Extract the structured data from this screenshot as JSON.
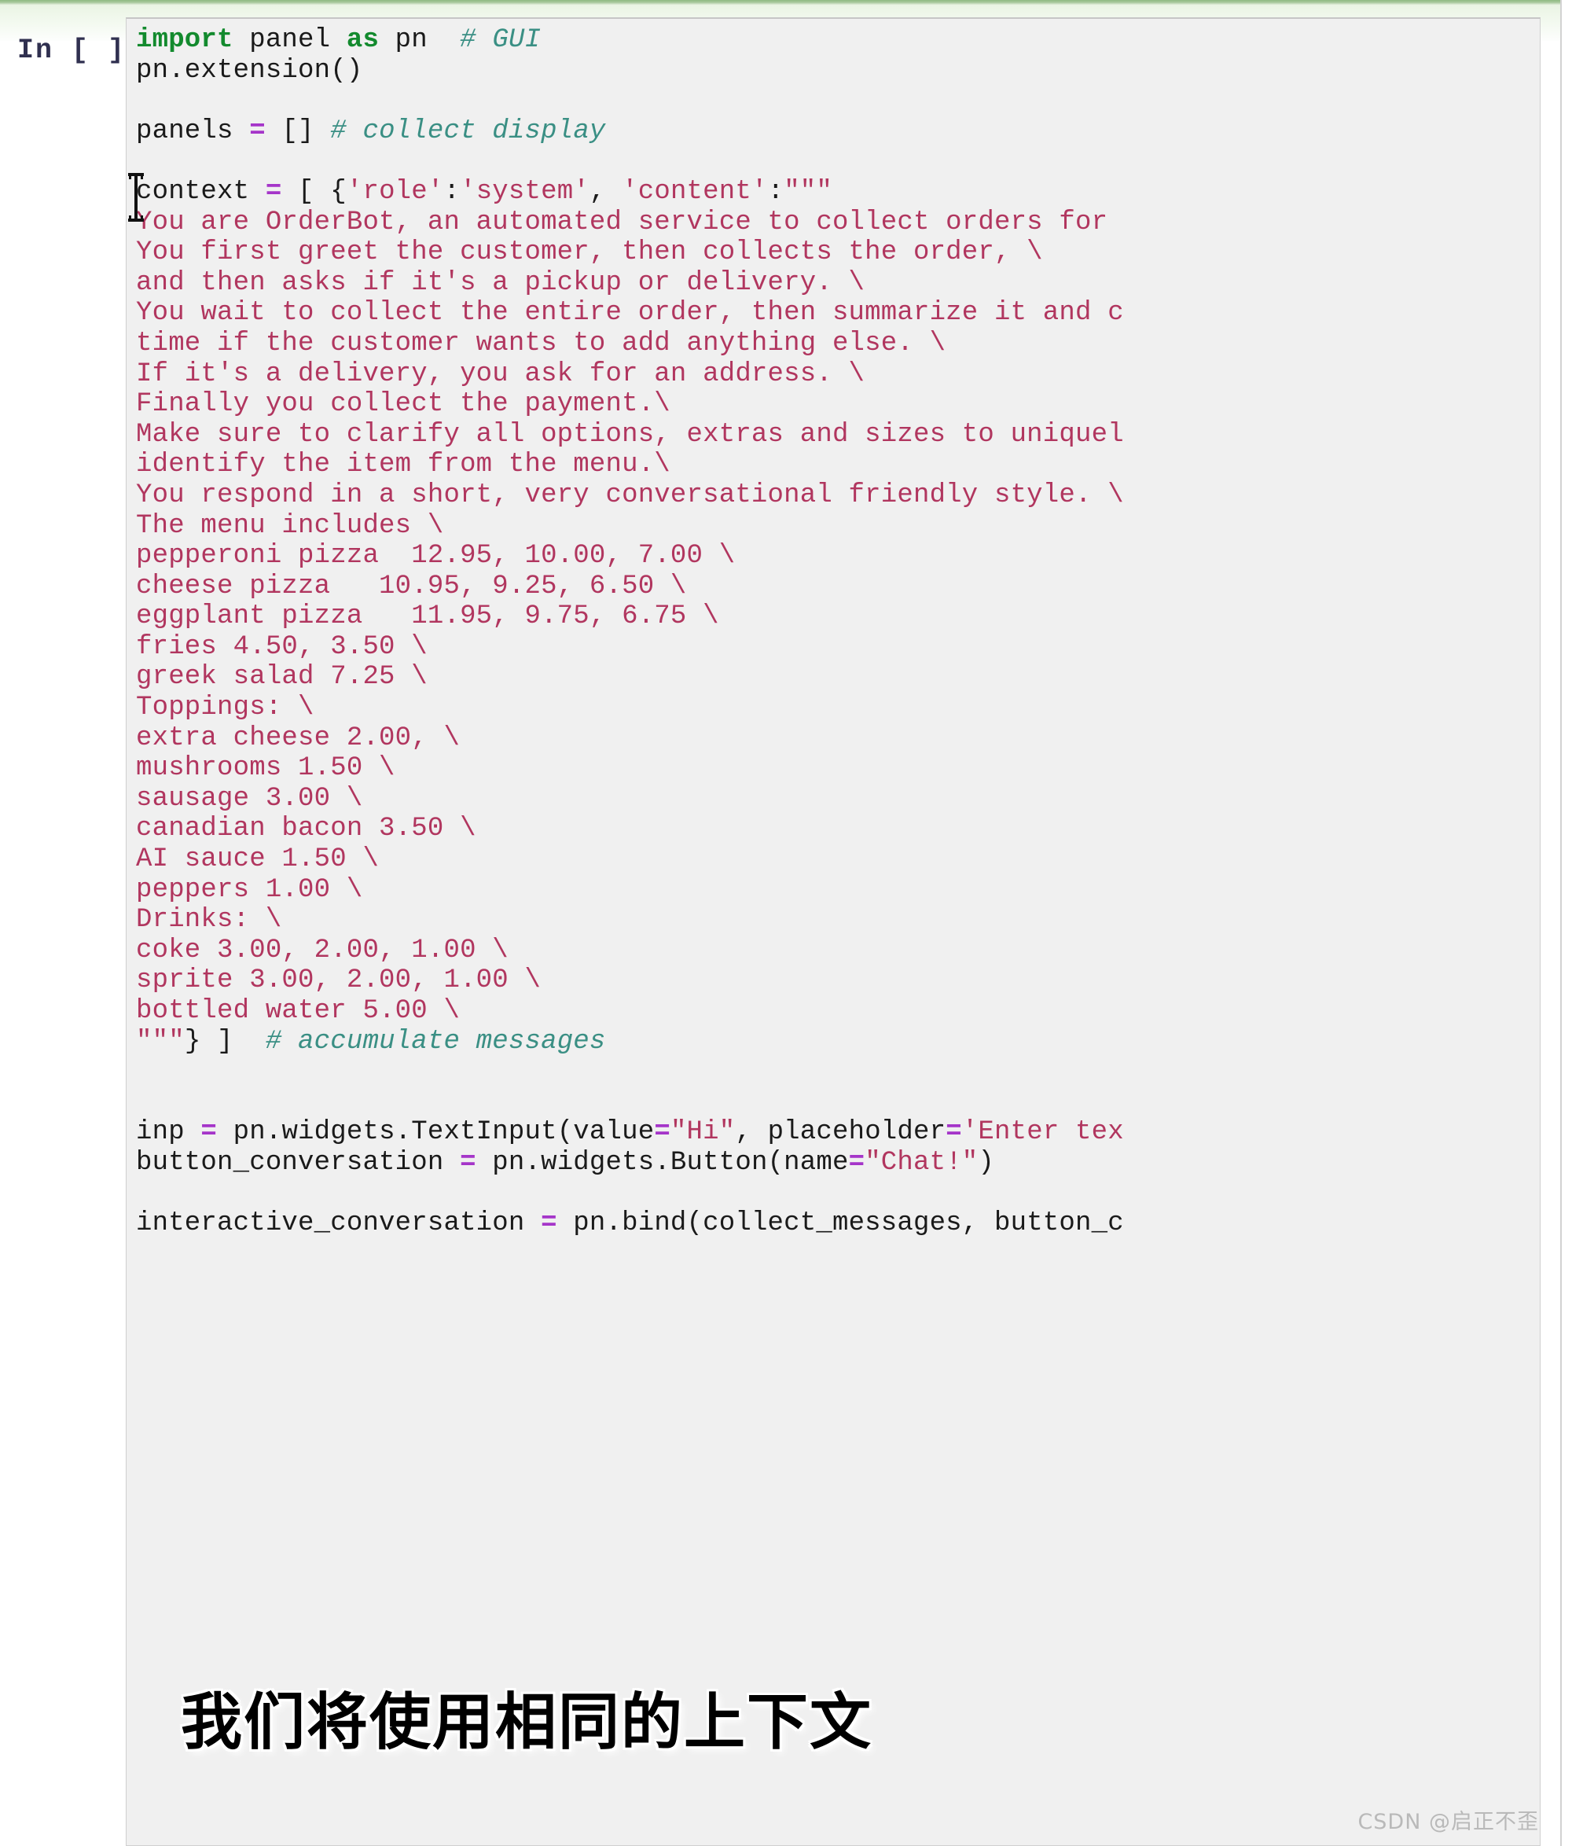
{
  "notebook": {
    "prompt_label": "In [ ]:",
    "cell_type": "code",
    "kernel_language": "python"
  },
  "code": {
    "lines": [
      [
        {
          "t": "kw",
          "s": "import"
        },
        {
          "t": "plain",
          "s": " panel "
        },
        {
          "t": "kw",
          "s": "as"
        },
        {
          "t": "plain",
          "s": " pn  "
        },
        {
          "t": "comment",
          "s": "# GUI"
        }
      ],
      [
        {
          "t": "plain",
          "s": "pn.extension()"
        }
      ],
      [
        {
          "t": "plain",
          "s": ""
        }
      ],
      [
        {
          "t": "plain",
          "s": "panels "
        },
        {
          "t": "op",
          "s": "="
        },
        {
          "t": "plain",
          "s": " [] "
        },
        {
          "t": "comment",
          "s": "# collect display"
        }
      ],
      [
        {
          "t": "plain",
          "s": ""
        }
      ],
      [
        {
          "t": "plain",
          "s": "context "
        },
        {
          "t": "op",
          "s": "="
        },
        {
          "t": "plain",
          "s": " [ {"
        },
        {
          "t": "str",
          "s": "'role'"
        },
        {
          "t": "punct",
          "s": ":"
        },
        {
          "t": "str",
          "s": "'system'"
        },
        {
          "t": "punct",
          "s": ", "
        },
        {
          "t": "str",
          "s": "'content'"
        },
        {
          "t": "punct",
          "s": ":"
        },
        {
          "t": "str",
          "s": "\"\"\""
        }
      ],
      [
        {
          "t": "str",
          "s": "You are OrderBot, an automated service to collect orders for"
        }
      ],
      [
        {
          "t": "str",
          "s": "You first greet the customer, then collects the order, \\"
        }
      ],
      [
        {
          "t": "str",
          "s": "and then asks if it's a pickup or delivery. \\"
        }
      ],
      [
        {
          "t": "str",
          "s": "You wait to collect the entire order, then summarize it and c"
        }
      ],
      [
        {
          "t": "str",
          "s": "time if the customer wants to add anything else. \\"
        }
      ],
      [
        {
          "t": "str",
          "s": "If it's a delivery, you ask for an address. \\"
        }
      ],
      [
        {
          "t": "str",
          "s": "Finally you collect the payment.\\"
        }
      ],
      [
        {
          "t": "str",
          "s": "Make sure to clarify all options, extras and sizes to uniquel"
        }
      ],
      [
        {
          "t": "str",
          "s": "identify the item from the menu.\\"
        }
      ],
      [
        {
          "t": "str",
          "s": "You respond in a short, very conversational friendly style. \\"
        }
      ],
      [
        {
          "t": "str",
          "s": "The menu includes \\"
        }
      ],
      [
        {
          "t": "str",
          "s": "pepperoni pizza  12.95, 10.00, 7.00 \\"
        }
      ],
      [
        {
          "t": "str",
          "s": "cheese pizza   10.95, 9.25, 6.50 \\"
        }
      ],
      [
        {
          "t": "str",
          "s": "eggplant pizza   11.95, 9.75, 6.75 \\"
        }
      ],
      [
        {
          "t": "str",
          "s": "fries 4.50, 3.50 \\"
        }
      ],
      [
        {
          "t": "str",
          "s": "greek salad 7.25 \\"
        }
      ],
      [
        {
          "t": "str",
          "s": "Toppings: \\"
        }
      ],
      [
        {
          "t": "str",
          "s": "extra cheese 2.00, \\"
        }
      ],
      [
        {
          "t": "str",
          "s": "mushrooms 1.50 \\"
        }
      ],
      [
        {
          "t": "str",
          "s": "sausage 3.00 \\"
        }
      ],
      [
        {
          "t": "str",
          "s": "canadian bacon 3.50 \\"
        }
      ],
      [
        {
          "t": "str",
          "s": "AI sauce 1.50 \\"
        }
      ],
      [
        {
          "t": "str",
          "s": "peppers 1.00 \\"
        }
      ],
      [
        {
          "t": "str",
          "s": "Drinks: \\"
        }
      ],
      [
        {
          "t": "str",
          "s": "coke 3.00, 2.00, 1.00 \\"
        }
      ],
      [
        {
          "t": "str",
          "s": "sprite 3.00, 2.00, 1.00 \\"
        }
      ],
      [
        {
          "t": "str",
          "s": "bottled water 5.00 \\"
        }
      ],
      [
        {
          "t": "str",
          "s": "\"\"\""
        },
        {
          "t": "punct",
          "s": "} ]  "
        },
        {
          "t": "comment",
          "s": "# accumulate messages"
        }
      ],
      [
        {
          "t": "plain",
          "s": ""
        }
      ],
      [
        {
          "t": "plain",
          "s": ""
        }
      ],
      [
        {
          "t": "plain",
          "s": "inp "
        },
        {
          "t": "op",
          "s": "="
        },
        {
          "t": "plain",
          "s": " pn.widgets.TextInput(value"
        },
        {
          "t": "op",
          "s": "="
        },
        {
          "t": "str",
          "s": "\"Hi\""
        },
        {
          "t": "punct",
          "s": ", "
        },
        {
          "t": "plain",
          "s": "placeholder"
        },
        {
          "t": "op",
          "s": "="
        },
        {
          "t": "str",
          "s": "'Enter tex"
        }
      ],
      [
        {
          "t": "plain",
          "s": "button_conversation "
        },
        {
          "t": "op",
          "s": "="
        },
        {
          "t": "plain",
          "s": " pn.widgets.Button(name"
        },
        {
          "t": "op",
          "s": "="
        },
        {
          "t": "str",
          "s": "\"Chat!\""
        },
        {
          "t": "punct",
          "s": ")"
        }
      ],
      [
        {
          "t": "plain",
          "s": ""
        }
      ],
      [
        {
          "t": "plain",
          "s": "interactive_conversation "
        },
        {
          "t": "op",
          "s": "="
        },
        {
          "t": "plain",
          "s": " pn.bind(collect_messages, button_c"
        }
      ]
    ]
  },
  "overlay": {
    "caption_text": "我们将使用相同的上下文",
    "watermark_text": "CSDN @启正不歪"
  },
  "colors": {
    "keyword": "#138a2e",
    "comment": "#3a8f84",
    "string": "#b1365f",
    "operator": "#a535c9",
    "plain": "#1a1a1a",
    "cell_background": "#f0f0f0",
    "prompt": "#303050",
    "accent_top_bar": "#8fb982"
  }
}
